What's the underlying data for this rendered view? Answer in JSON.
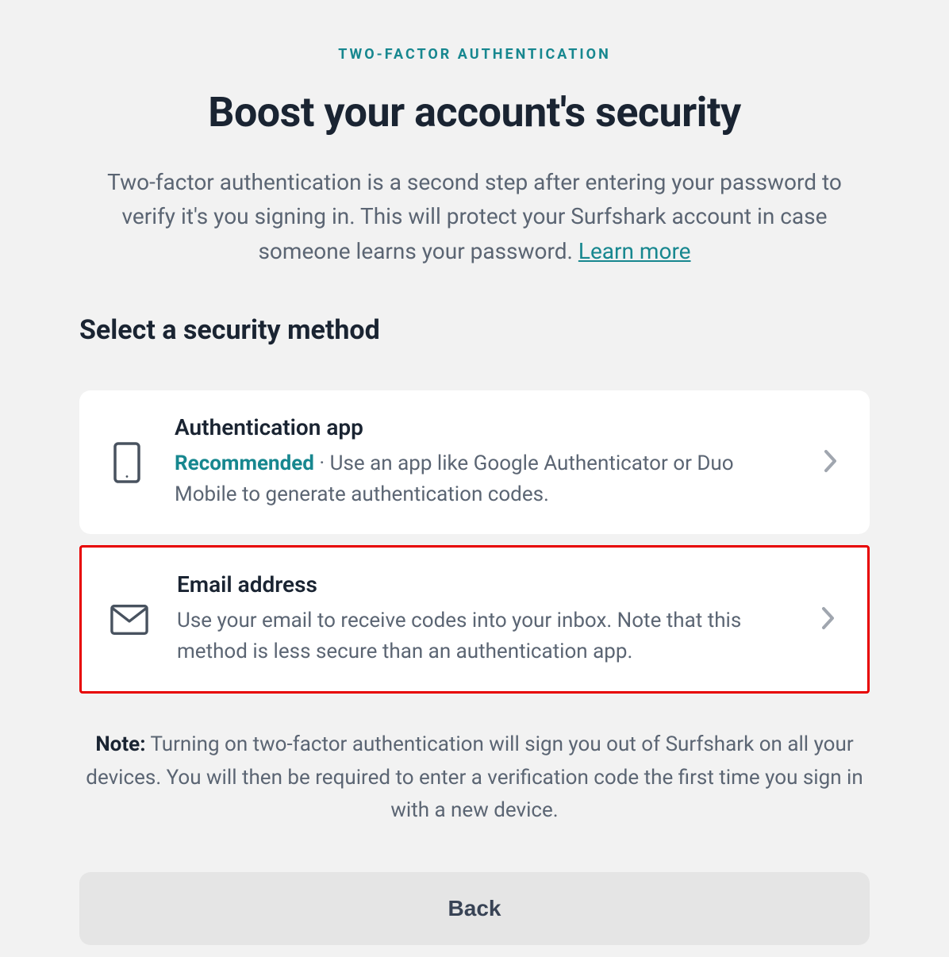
{
  "eyebrow": "TWO-FACTOR AUTHENTICATION",
  "title": "Boost your account's security",
  "intro_text": "Two-factor authentication is a second step after entering your password to verify it's you signing in. This will protect your Surfshark account in case someone learns your password. ",
  "learn_more": "Learn more",
  "section_title": "Select a security method",
  "methods": {
    "app": {
      "title": "Authentication app",
      "recommended_label": "Recommended",
      "separator": " · ",
      "description": "Use an app like Google Authenticator or Duo Mobile to generate authentication codes."
    },
    "email": {
      "title": "Email address",
      "description": "Use your email to receive codes into your inbox. Note that this method is less secure than an authentication app."
    }
  },
  "note_label": "Note:",
  "note_text": " Turning on two-factor authentication will sign you out of Surfshark on all your devices. You will then be required to enter a verification code the first time you sign in with a new device.",
  "back_button": "Back"
}
